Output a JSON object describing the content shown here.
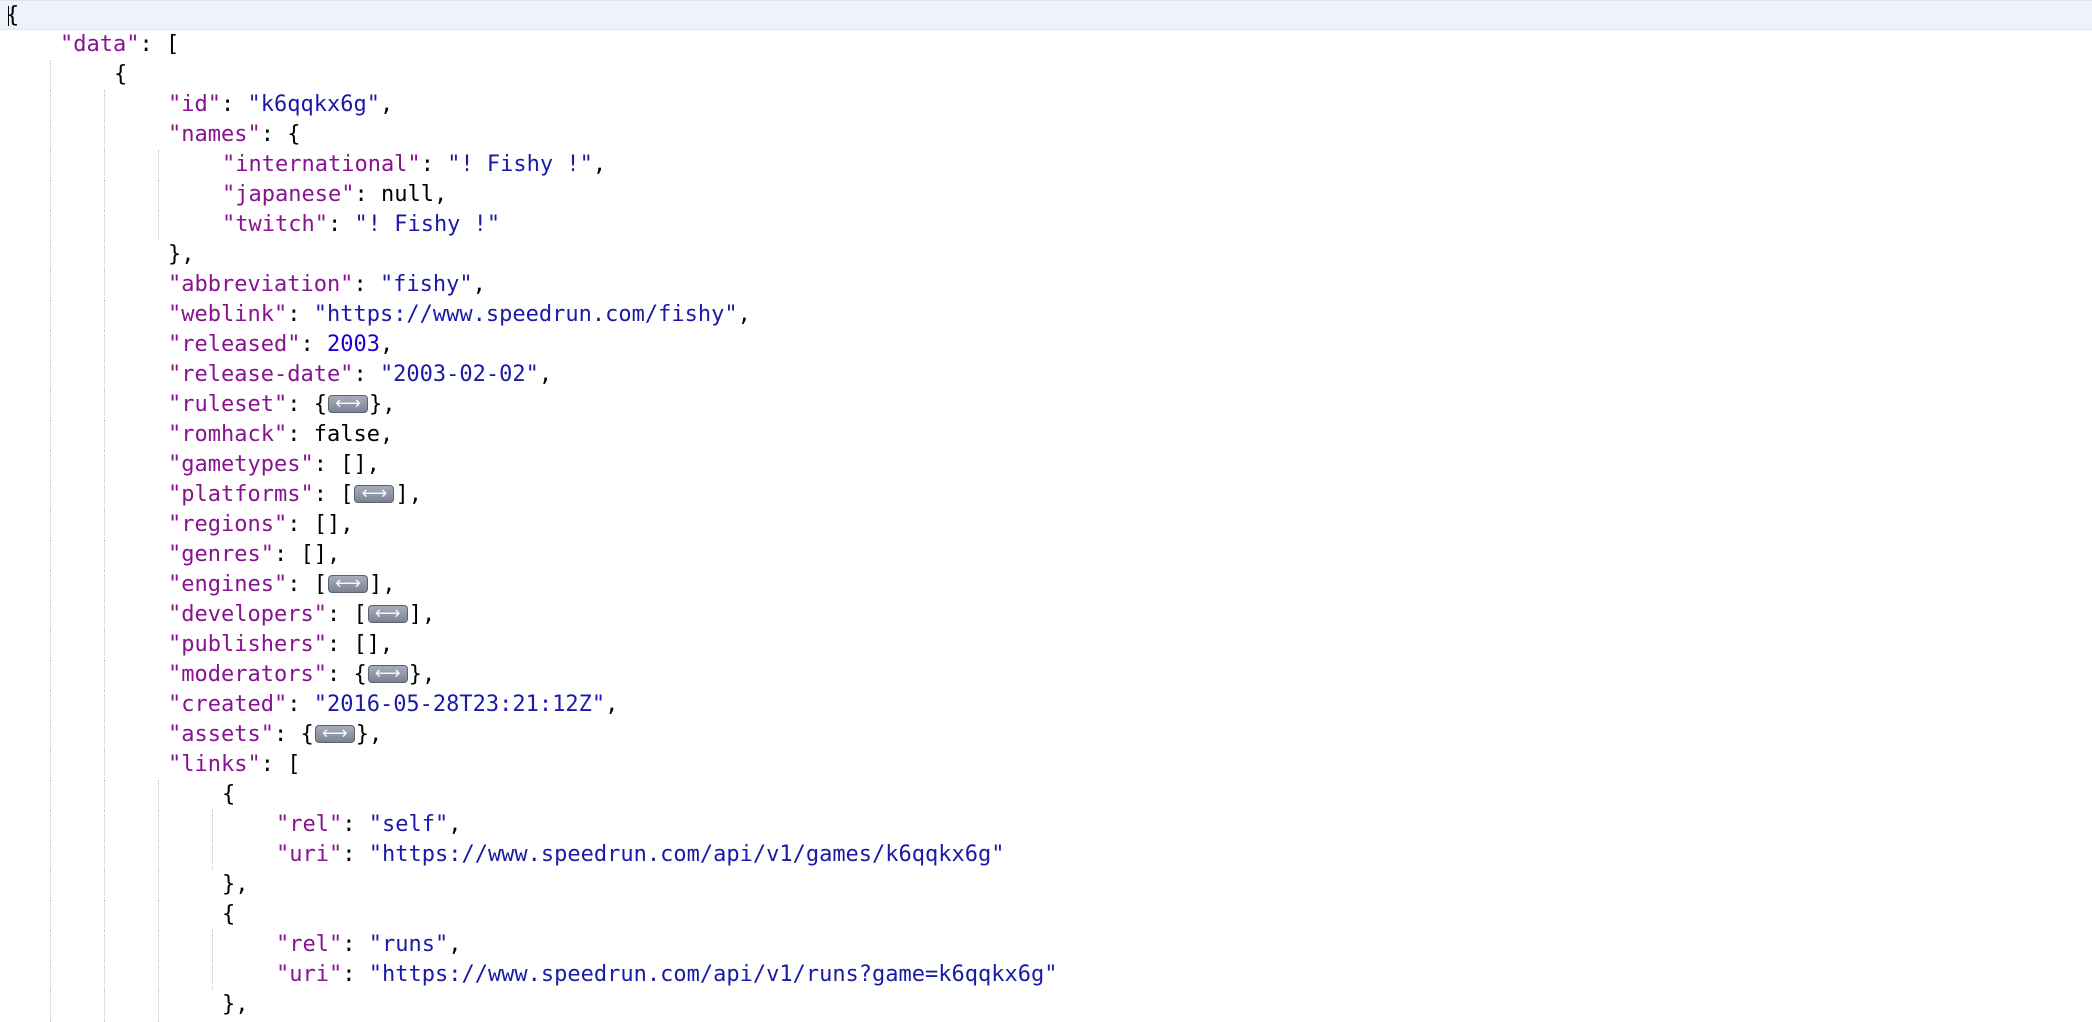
{
  "lines": [
    {
      "indent": 0,
      "current": true,
      "tokens": [
        {
          "t": "pun",
          "v": "{"
        }
      ]
    },
    {
      "indent": 1,
      "tokens": [
        {
          "t": "key",
          "v": "\"data\""
        },
        {
          "t": "pun",
          "v": ": ["
        }
      ]
    },
    {
      "indent": 2,
      "tokens": [
        {
          "t": "pun",
          "v": "{"
        }
      ]
    },
    {
      "indent": 3,
      "tokens": [
        {
          "t": "key",
          "v": "\"id\""
        },
        {
          "t": "pun",
          "v": ": "
        },
        {
          "t": "str",
          "v": "\"k6qqkx6g\""
        },
        {
          "t": "pun",
          "v": ","
        }
      ]
    },
    {
      "indent": 3,
      "tokens": [
        {
          "t": "key",
          "v": "\"names\""
        },
        {
          "t": "pun",
          "v": ": {"
        }
      ]
    },
    {
      "indent": 4,
      "tokens": [
        {
          "t": "key",
          "v": "\"international\""
        },
        {
          "t": "pun",
          "v": ": "
        },
        {
          "t": "str",
          "v": "\"! Fishy !\""
        },
        {
          "t": "pun",
          "v": ","
        }
      ]
    },
    {
      "indent": 4,
      "tokens": [
        {
          "t": "key",
          "v": "\"japanese\""
        },
        {
          "t": "pun",
          "v": ": "
        },
        {
          "t": "lit",
          "v": "null"
        },
        {
          "t": "pun",
          "v": ","
        }
      ]
    },
    {
      "indent": 4,
      "tokens": [
        {
          "t": "key",
          "v": "\"twitch\""
        },
        {
          "t": "pun",
          "v": ": "
        },
        {
          "t": "str",
          "v": "\"! Fishy !\""
        }
      ]
    },
    {
      "indent": 3,
      "tokens": [
        {
          "t": "pun",
          "v": "},"
        }
      ]
    },
    {
      "indent": 3,
      "tokens": [
        {
          "t": "key",
          "v": "\"abbreviation\""
        },
        {
          "t": "pun",
          "v": ": "
        },
        {
          "t": "str",
          "v": "\"fishy\""
        },
        {
          "t": "pun",
          "v": ","
        }
      ]
    },
    {
      "indent": 3,
      "tokens": [
        {
          "t": "key",
          "v": "\"weblink\""
        },
        {
          "t": "pun",
          "v": ": "
        },
        {
          "t": "str",
          "v": "\"https://www.speedrun.com/fishy\""
        },
        {
          "t": "pun",
          "v": ","
        }
      ]
    },
    {
      "indent": 3,
      "tokens": [
        {
          "t": "key",
          "v": "\"released\""
        },
        {
          "t": "pun",
          "v": ": "
        },
        {
          "t": "num",
          "v": "2003"
        },
        {
          "t": "pun",
          "v": ","
        }
      ]
    },
    {
      "indent": 3,
      "tokens": [
        {
          "t": "key",
          "v": "\"release-date\""
        },
        {
          "t": "pun",
          "v": ": "
        },
        {
          "t": "str",
          "v": "\"2003-02-02\""
        },
        {
          "t": "pun",
          "v": ","
        }
      ]
    },
    {
      "indent": 3,
      "tokens": [
        {
          "t": "key",
          "v": "\"ruleset\""
        },
        {
          "t": "pun",
          "v": ": {"
        },
        {
          "t": "toggle",
          "v": "ruleset"
        },
        {
          "t": "pun",
          "v": "},"
        }
      ]
    },
    {
      "indent": 3,
      "tokens": [
        {
          "t": "key",
          "v": "\"romhack\""
        },
        {
          "t": "pun",
          "v": ": "
        },
        {
          "t": "lit",
          "v": "false"
        },
        {
          "t": "pun",
          "v": ","
        }
      ]
    },
    {
      "indent": 3,
      "tokens": [
        {
          "t": "key",
          "v": "\"gametypes\""
        },
        {
          "t": "pun",
          "v": ": [],"
        }
      ]
    },
    {
      "indent": 3,
      "tokens": [
        {
          "t": "key",
          "v": "\"platforms\""
        },
        {
          "t": "pun",
          "v": ": ["
        },
        {
          "t": "toggle",
          "v": "platforms"
        },
        {
          "t": "pun",
          "v": "],"
        }
      ]
    },
    {
      "indent": 3,
      "tokens": [
        {
          "t": "key",
          "v": "\"regions\""
        },
        {
          "t": "pun",
          "v": ": [],"
        }
      ]
    },
    {
      "indent": 3,
      "tokens": [
        {
          "t": "key",
          "v": "\"genres\""
        },
        {
          "t": "pun",
          "v": ": [],"
        }
      ]
    },
    {
      "indent": 3,
      "tokens": [
        {
          "t": "key",
          "v": "\"engines\""
        },
        {
          "t": "pun",
          "v": ": ["
        },
        {
          "t": "toggle",
          "v": "engines"
        },
        {
          "t": "pun",
          "v": "],"
        }
      ]
    },
    {
      "indent": 3,
      "tokens": [
        {
          "t": "key",
          "v": "\"developers\""
        },
        {
          "t": "pun",
          "v": ": ["
        },
        {
          "t": "toggle",
          "v": "developers"
        },
        {
          "t": "pun",
          "v": "],"
        }
      ]
    },
    {
      "indent": 3,
      "tokens": [
        {
          "t": "key",
          "v": "\"publishers\""
        },
        {
          "t": "pun",
          "v": ": [],"
        }
      ]
    },
    {
      "indent": 3,
      "tokens": [
        {
          "t": "key",
          "v": "\"moderators\""
        },
        {
          "t": "pun",
          "v": ": {"
        },
        {
          "t": "toggle",
          "v": "moderators"
        },
        {
          "t": "pun",
          "v": "},"
        }
      ]
    },
    {
      "indent": 3,
      "tokens": [
        {
          "t": "key",
          "v": "\"created\""
        },
        {
          "t": "pun",
          "v": ": "
        },
        {
          "t": "str",
          "v": "\"2016-05-28T23:21:12Z\""
        },
        {
          "t": "pun",
          "v": ","
        }
      ]
    },
    {
      "indent": 3,
      "tokens": [
        {
          "t": "key",
          "v": "\"assets\""
        },
        {
          "t": "pun",
          "v": ": {"
        },
        {
          "t": "toggle",
          "v": "assets"
        },
        {
          "t": "pun",
          "v": "},"
        }
      ]
    },
    {
      "indent": 3,
      "tokens": [
        {
          "t": "key",
          "v": "\"links\""
        },
        {
          "t": "pun",
          "v": ": ["
        }
      ]
    },
    {
      "indent": 4,
      "tokens": [
        {
          "t": "pun",
          "v": "{"
        }
      ]
    },
    {
      "indent": 5,
      "tokens": [
        {
          "t": "key",
          "v": "\"rel\""
        },
        {
          "t": "pun",
          "v": ": "
        },
        {
          "t": "str",
          "v": "\"self\""
        },
        {
          "t": "pun",
          "v": ","
        }
      ]
    },
    {
      "indent": 5,
      "tokens": [
        {
          "t": "key",
          "v": "\"uri\""
        },
        {
          "t": "pun",
          "v": ": "
        },
        {
          "t": "str",
          "v": "\"https://www.speedrun.com/api/v1/games/k6qqkx6g\""
        }
      ]
    },
    {
      "indent": 4,
      "tokens": [
        {
          "t": "pun",
          "v": "},"
        }
      ]
    },
    {
      "indent": 4,
      "tokens": [
        {
          "t": "pun",
          "v": "{"
        }
      ]
    },
    {
      "indent": 5,
      "tokens": [
        {
          "t": "key",
          "v": "\"rel\""
        },
        {
          "t": "pun",
          "v": ": "
        },
        {
          "t": "str",
          "v": "\"runs\""
        },
        {
          "t": "pun",
          "v": ","
        }
      ]
    },
    {
      "indent": 5,
      "tokens": [
        {
          "t": "key",
          "v": "\"uri\""
        },
        {
          "t": "pun",
          "v": ": "
        },
        {
          "t": "str",
          "v": "\"https://www.speedrun.com/api/v1/runs?game=k6qqkx6g\""
        }
      ]
    },
    {
      "indent": 4,
      "tokens": [
        {
          "t": "pun",
          "v": "},"
        }
      ]
    },
    {
      "indent": 4,
      "tokens": [
        {
          "t": "pun",
          "v": "{"
        }
      ]
    }
  ],
  "colors": {
    "key": "#881391",
    "string": "#1a1aa6",
    "number": "#1c00cf",
    "literal": "#000000",
    "current_line": "#eef2fb"
  },
  "icons": {
    "collapsed": "collapsed-content-icon"
  }
}
